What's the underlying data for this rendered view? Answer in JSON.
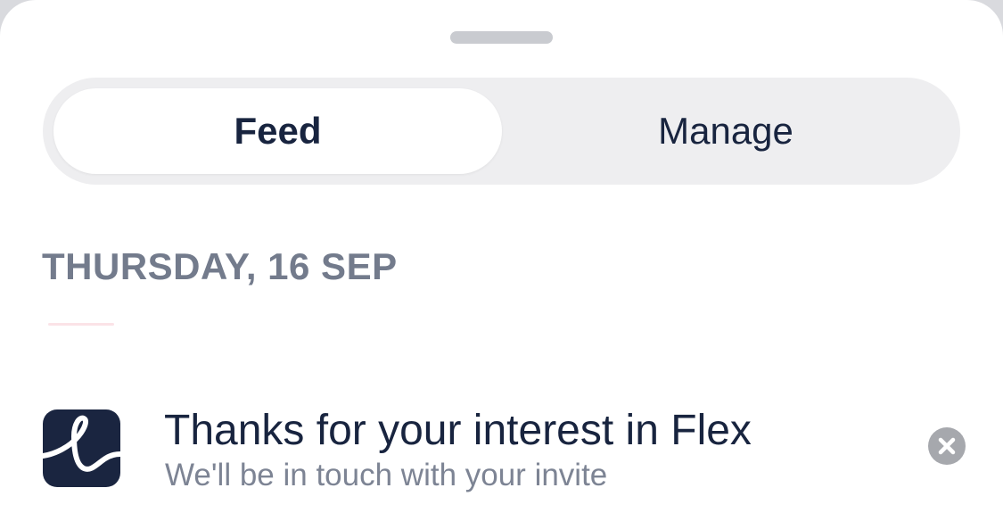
{
  "segmented_control": {
    "tabs": [
      {
        "label": "Feed",
        "selected": true
      },
      {
        "label": "Manage",
        "selected": false
      }
    ]
  },
  "feed": {
    "date_header": "THURSDAY, 16 SEP",
    "notifications": [
      {
        "app_icon": "flex-logo-icon",
        "title": "Thanks for your interest in Flex",
        "subtitle": "We'll be in touch with your invite",
        "dismiss_icon": "close-circle-icon"
      }
    ]
  },
  "colors": {
    "text_primary": "#18243f",
    "text_secondary": "#737b8c",
    "segment_track": "#eeeef0",
    "app_icon_bg": "#1a2540"
  }
}
